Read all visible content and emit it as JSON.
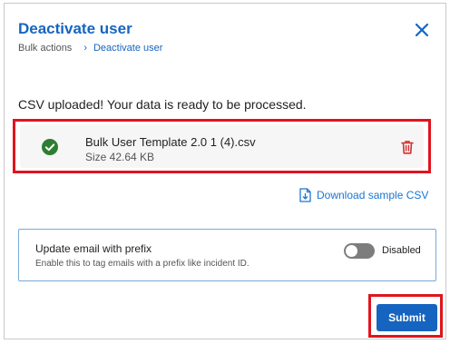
{
  "dialog": {
    "title": "Deactivate user",
    "breadcrumb": [
      "Bulk actions",
      "Deactivate user"
    ],
    "status_message": "CSV uploaded! Your data is ready to be processed."
  },
  "file": {
    "name": "Bulk User Template 2.0 1 (4).csv",
    "size": "Size 42.64 KB"
  },
  "download_link": "Download sample CSV",
  "prefix_setting": {
    "title": "Update email with prefix",
    "description": "Enable this to tag emails with a prefix like incident ID.",
    "state_label": "Disabled",
    "enabled": false
  },
  "submit_label": "Submit",
  "colors": {
    "primary": "#1565c0",
    "success": "#2e7d32",
    "danger": "#e0141e",
    "highlight": "#e0141e"
  },
  "icons": [
    "close-icon",
    "chevron-right-icon",
    "check-circle-icon",
    "trash-icon",
    "download-file-icon"
  ]
}
